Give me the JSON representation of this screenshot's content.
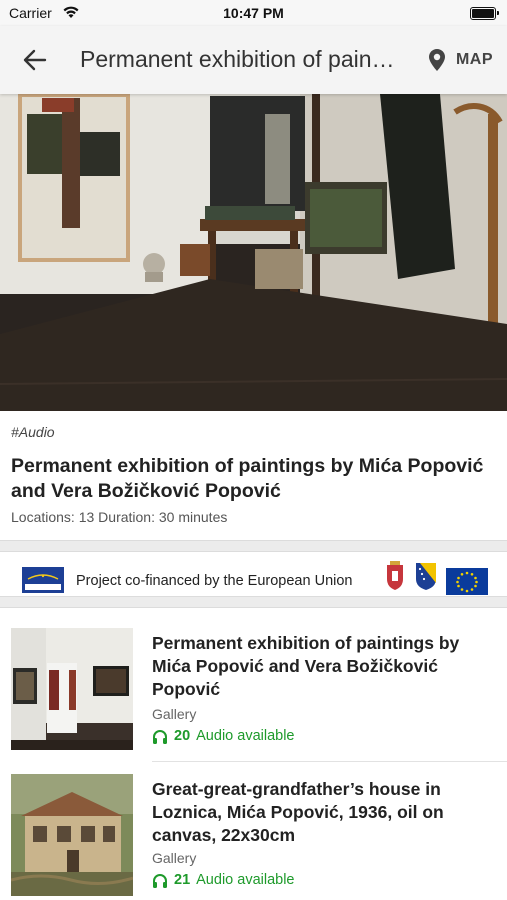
{
  "status_bar": {
    "carrier": "Carrier",
    "time": "10:47 PM"
  },
  "app_bar": {
    "title": "Permanent exhibition of paintings by Mića Popović and Vera Božičković Popović",
    "map_label": "MAP"
  },
  "tour": {
    "tag": "#Audio",
    "title": "Permanent exhibition of paintings by Mića Popović and Vera Božičković Popović",
    "meta": "Locations: 13 Duration: 30 minutes"
  },
  "eu_banner": {
    "text": "Project co-financed by the European Union"
  },
  "items": [
    {
      "title": "Permanent exhibition of paintings by Mića Popović and Vera Božičković Popović",
      "category": "Gallery",
      "audio_count": "20",
      "audio_label": "Audio available"
    },
    {
      "title": "Great-great-grandfather’s house in Loznica, Mića Popović, 1936, oil on canvas, 22x30cm",
      "category": "Gallery",
      "audio_count": "21",
      "audio_label": "Audio available"
    }
  ],
  "colors": {
    "accent_green": "#1e9a2b",
    "app_bar_bg": "#f4f4f4",
    "eu_blue": "#0a3b9c"
  },
  "icons": [
    "wifi-icon",
    "battery-icon",
    "back-arrow-icon",
    "map-pin-icon",
    "headphones-icon"
  ]
}
